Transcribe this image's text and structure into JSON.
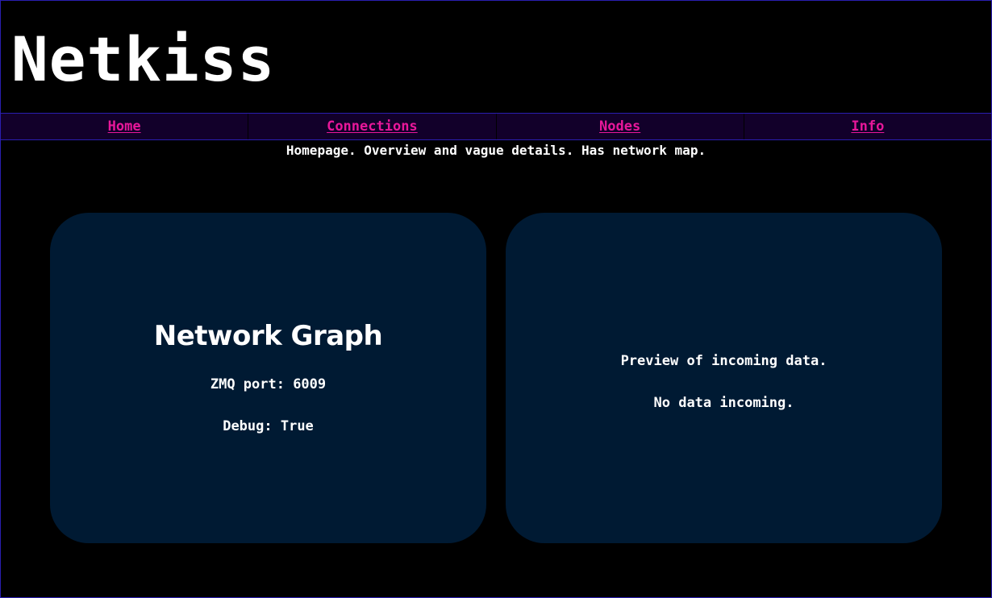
{
  "header": {
    "title": "Netkiss"
  },
  "nav": {
    "items": [
      {
        "label": "Home"
      },
      {
        "label": "Connections"
      },
      {
        "label": "Nodes"
      },
      {
        "label": "Info"
      }
    ]
  },
  "page": {
    "description": "Homepage. Overview and vague details. Has network map."
  },
  "network_card": {
    "title": "Network Graph",
    "zmq_port": "ZMQ port: 6009",
    "debug": "Debug: True"
  },
  "preview_card": {
    "heading": "Preview of incoming data.",
    "status": "No data incoming."
  },
  "colors": {
    "background": "#000000",
    "nav_background": "#12002a",
    "nav_link": "#e8179a",
    "border": "#2a1fb0",
    "card_background": "#001a33",
    "text": "#ffffff"
  }
}
